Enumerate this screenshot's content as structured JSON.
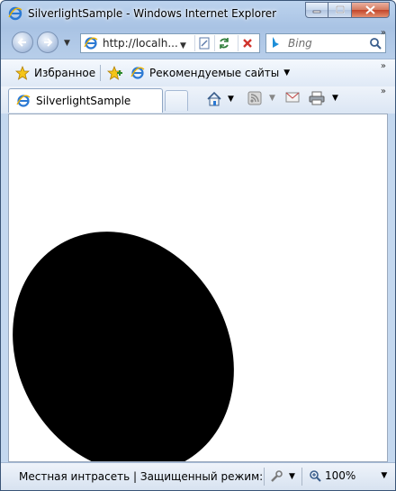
{
  "window": {
    "title": "SilverlightSample - Windows Internet Explorer"
  },
  "nav": {
    "address": "http://localh...",
    "search_placeholder": "Bing",
    "search_brand_icon": "bing-icon"
  },
  "favorites": {
    "favorites_label": "Избранное",
    "suggested_sites_label": "Рекомендуемые сайты"
  },
  "tabs": [
    {
      "label": "SilverlightSample"
    }
  ],
  "status": {
    "zone_text": "Местная интрасеть | Защищенный режим: вы",
    "zoom": "100%"
  },
  "colors": {
    "ellipse_fill": "#000000",
    "page_background": "#ffffff"
  }
}
